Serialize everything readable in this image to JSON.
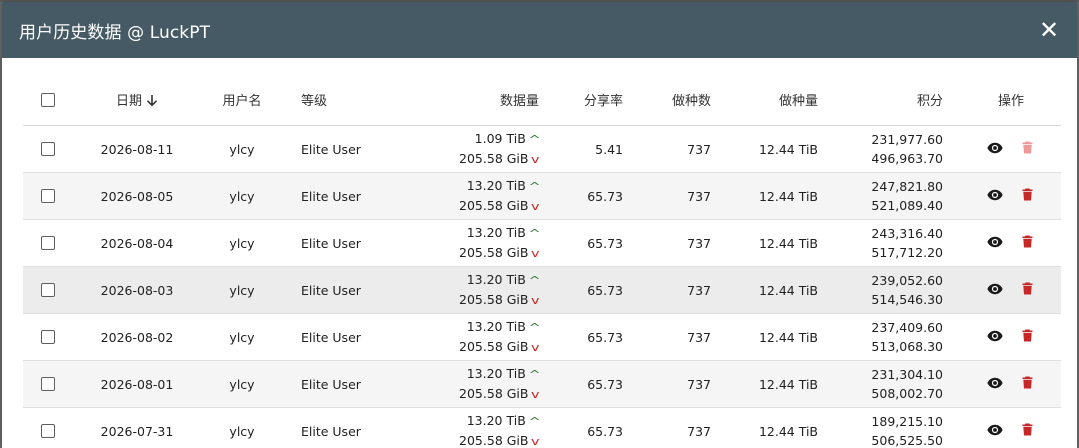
{
  "dialog": {
    "title": "用户历史数据 @ LuckPT",
    "close_icon": "close-icon"
  },
  "table": {
    "headers": {
      "date": "日期",
      "username": "用户名",
      "level": "等级",
      "data": "数据量",
      "ratio": "分享率",
      "seeding_count": "做种数",
      "seeding_size": "做种量",
      "bonus": "积分",
      "actions": "操作"
    },
    "rows": [
      {
        "date": "2026-08-11",
        "username": "ylcy",
        "level": "Elite User",
        "upload": "1.09 TiB",
        "download": "205.58 GiB",
        "ratio": "5.41",
        "seeding_count": "737",
        "seeding_size": "12.44 TiB",
        "bonus": "231,977.60",
        "bonus_per_hour": "496,963.70",
        "delete_enabled": false
      },
      {
        "date": "2026-08-05",
        "username": "ylcy",
        "level": "Elite User",
        "upload": "13.20 TiB",
        "download": "205.58 GiB",
        "ratio": "65.73",
        "seeding_count": "737",
        "seeding_size": "12.44 TiB",
        "bonus": "247,821.80",
        "bonus_per_hour": "521,089.40",
        "delete_enabled": true
      },
      {
        "date": "2026-08-04",
        "username": "ylcy",
        "level": "Elite User",
        "upload": "13.20 TiB",
        "download": "205.58 GiB",
        "ratio": "65.73",
        "seeding_count": "737",
        "seeding_size": "12.44 TiB",
        "bonus": "243,316.40",
        "bonus_per_hour": "517,712.20",
        "delete_enabled": true
      },
      {
        "date": "2026-08-03",
        "username": "ylcy",
        "level": "Elite User",
        "upload": "13.20 TiB",
        "download": "205.58 GiB",
        "ratio": "65.73",
        "seeding_count": "737",
        "seeding_size": "12.44 TiB",
        "bonus": "239,052.60",
        "bonus_per_hour": "514,546.30",
        "delete_enabled": true
      },
      {
        "date": "2026-08-02",
        "username": "ylcy",
        "level": "Elite User",
        "upload": "13.20 TiB",
        "download": "205.58 GiB",
        "ratio": "65.73",
        "seeding_count": "737",
        "seeding_size": "12.44 TiB",
        "bonus": "237,409.60",
        "bonus_per_hour": "513,068.30",
        "delete_enabled": true
      },
      {
        "date": "2026-08-01",
        "username": "ylcy",
        "level": "Elite User",
        "upload": "13.20 TiB",
        "download": "205.58 GiB",
        "ratio": "65.73",
        "seeding_count": "737",
        "seeding_size": "12.44 TiB",
        "bonus": "231,304.10",
        "bonus_per_hour": "508,002.70",
        "delete_enabled": true
      },
      {
        "date": "2026-07-31",
        "username": "ylcy",
        "level": "Elite User",
        "upload": "13.20 TiB",
        "download": "205.58 GiB",
        "ratio": "65.73",
        "seeding_count": "737",
        "seeding_size": "12.44 TiB",
        "bonus": "189,215.10",
        "bonus_per_hour": "506,525.50",
        "delete_enabled": true
      }
    ]
  },
  "colors": {
    "titlebar": "#455a64",
    "upload_arrow": "#2e7d32",
    "download_arrow": "#c62828",
    "delete_icon": "#c62828",
    "delete_icon_disabled": "#ef9a9a"
  },
  "icons": {
    "sort": "arrow-down-icon",
    "view": "eye-icon",
    "delete": "trash-icon"
  }
}
